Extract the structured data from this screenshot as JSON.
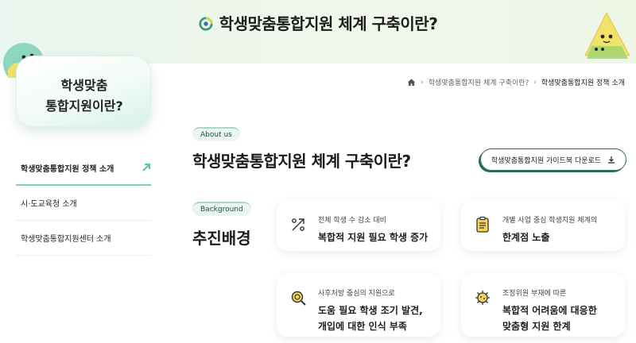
{
  "banner": {
    "title": "학생맞춤통합지원 체계 구축이란?"
  },
  "sidebar": {
    "card_title": "학생맞춤\n통합지원이란?",
    "items": [
      {
        "label": "학생맞춤통합지원 정책 소개",
        "active": true
      },
      {
        "label": "시·도교육청 소개"
      },
      {
        "label": "학생맞춤통합지원센터 소개"
      }
    ]
  },
  "breadcrumb": {
    "items": [
      "학생맞춤통합지원 체계 구축이란?",
      "학생맞춤통합지원 정책 소개"
    ]
  },
  "about": {
    "tag": "About us",
    "title": "학생맞춤통합지원 체계 구축이란?",
    "guide_button": "학생맞춤통합지원 가이드북 다운로드"
  },
  "background": {
    "tag": "Background",
    "title": "추진배경",
    "cards": [
      {
        "small": "전체 학생 수 감소 대비",
        "big": "복합적 지원 필요 학생 증가",
        "icon": "percent-trend-icon"
      },
      {
        "small": "개별 사업 중심 학생지원 체계의",
        "big": "한계점 노출",
        "icon": "clipboard-icon"
      },
      {
        "small": "사후처방 중심의 지원으로",
        "big": "도움 필요 학생 조기 발견,\n개입에 대한 인식 부족",
        "icon": "magnifier-icon"
      },
      {
        "small": "조정위원 부재에 따른",
        "big": "복합적 어려움에 대응한\n맞춤형 지원 한계",
        "icon": "virus-icon"
      }
    ]
  },
  "colors": {
    "accent": "#2e6b54",
    "mint": "#7bd0b2",
    "banner_bg": "#eaf6ef"
  }
}
